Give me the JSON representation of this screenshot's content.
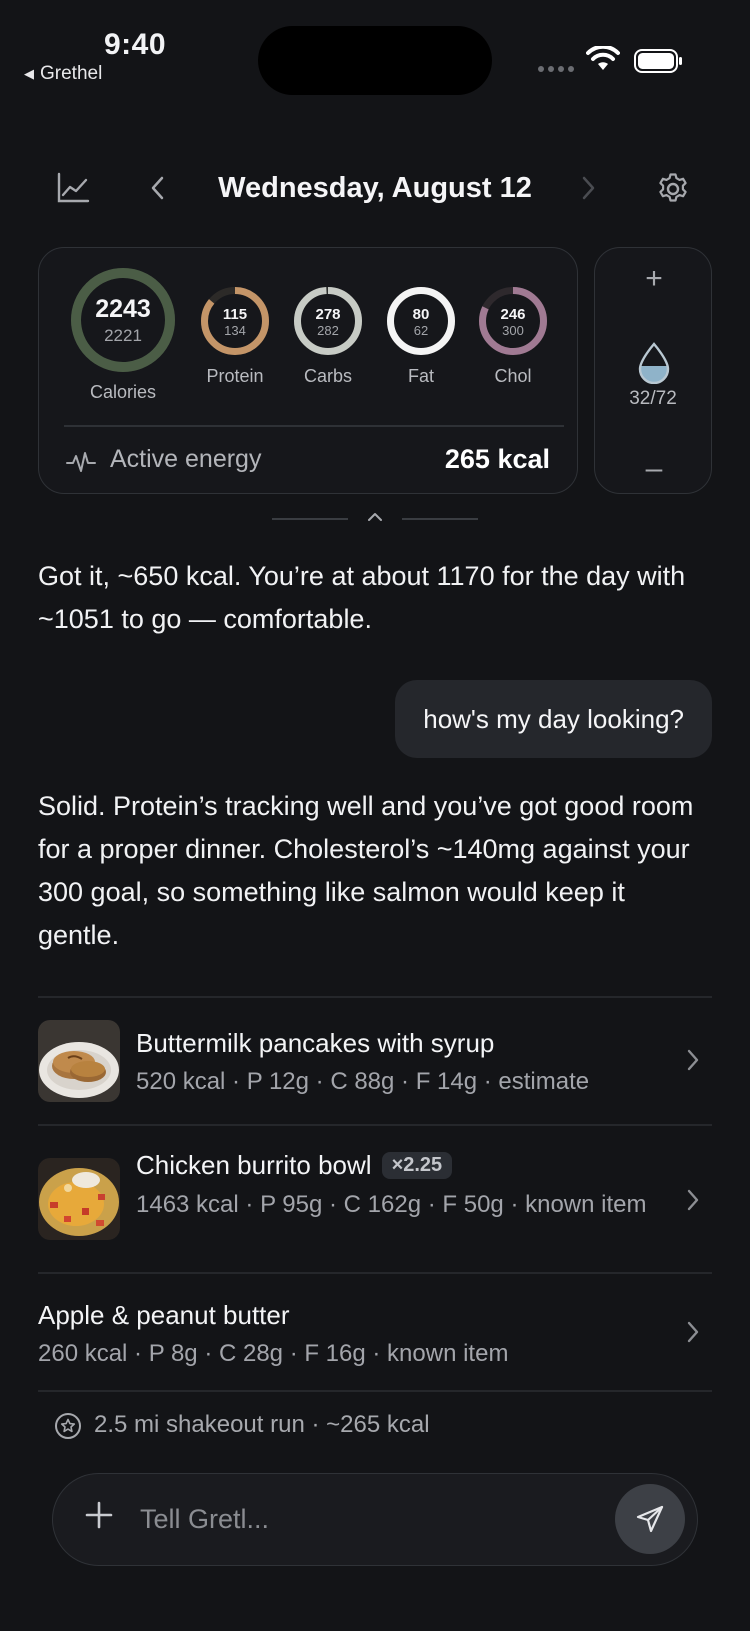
{
  "status_bar": {
    "time": "9:40",
    "back_app": "Grethel"
  },
  "header": {
    "date": "Wednesday, August 12"
  },
  "summary": {
    "calories": {
      "value": "2243",
      "goal": "2221",
      "label": "Calories",
      "progress": 1.0,
      "color": "#4b5d46"
    },
    "macros": [
      {
        "value": "115",
        "goal": "134",
        "label": "Protein",
        "progress": 0.86,
        "color": "#c49568"
      },
      {
        "value": "278",
        "goal": "282",
        "label": "Carbs",
        "progress": 0.99,
        "color": "#c7cbc5"
      },
      {
        "value": "80",
        "goal": "62",
        "label": "Fat",
        "progress": 1.0,
        "color": "#f4f4f4"
      },
      {
        "value": "246",
        "goal": "300",
        "label": "Chol",
        "progress": 0.82,
        "color": "#a07a93"
      }
    ],
    "active_energy_label": "Active energy",
    "active_energy_value": "265 kcal"
  },
  "water": {
    "count": "32/72",
    "plus": "+",
    "minus": "–"
  },
  "chat": {
    "assistant_1": "Got it, ~650 kcal. You’re at about 1170 for the day with ~1051 to go — comfortable.",
    "user_1": "how's my day looking?",
    "assistant_2": "Solid. Protein’s tracking well and you’ve got good room for a proper dinner. Cholesterol’s ~140mg against your 300 goal, so something like salmon would keep it gentle."
  },
  "foods": [
    {
      "name": "Buttermilk pancakes with syrup",
      "meta": "520 kcal · P 12g · C 88g · F 14g · estimate",
      "thumb_icon": "pancakes-photo"
    },
    {
      "name": "Chicken burrito bowl",
      "badge": "×2.25",
      "meta": "1463 kcal · P 95g · C 162g · F 50g · known item",
      "thumb_icon": "burrito-bowl-photo"
    },
    {
      "name": "Apple & peanut butter",
      "meta": "260 kcal · P 8g · C 28g · F 16g · known item"
    }
  ],
  "activity": {
    "text": "2.5 mi shakeout run · ~265 kcal",
    "icon": "star-badge-icon"
  },
  "composer": {
    "placeholder": "Tell Gretl..."
  }
}
